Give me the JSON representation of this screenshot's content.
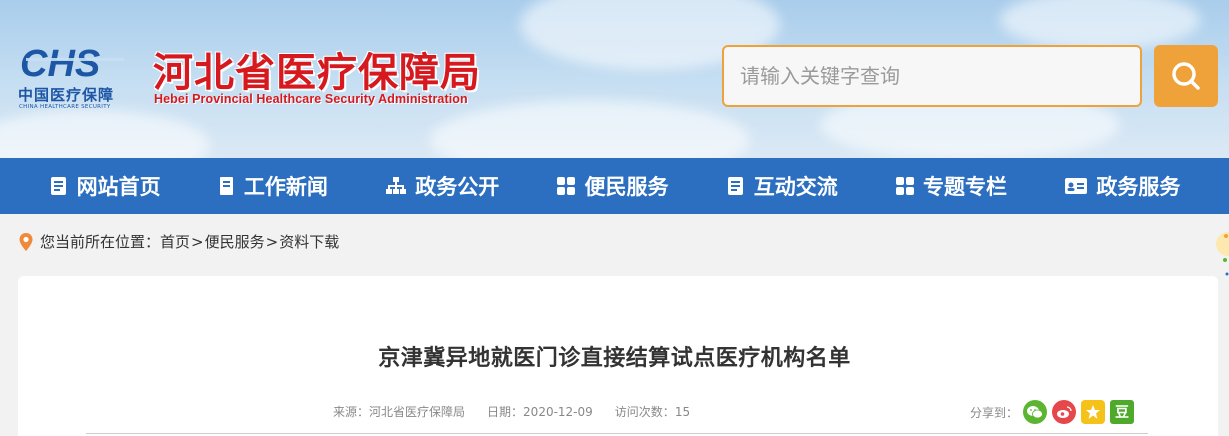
{
  "header": {
    "logo_cn": "中国医疗保障",
    "logo_en": "CHINA HEALTHCARE SECURITY",
    "title": "河北省医疗保障局",
    "subtitle": "Hebei Provincial Healthcare Security Administration"
  },
  "search": {
    "placeholder": "请输入关键字查询",
    "value": ""
  },
  "nav": {
    "items": [
      {
        "label": "网站首页",
        "icon": "list-icon"
      },
      {
        "label": "工作新闻",
        "icon": "bookmark-icon"
      },
      {
        "label": "政务公开",
        "icon": "hierarchy-icon"
      },
      {
        "label": "便民服务",
        "icon": "grid-icon"
      },
      {
        "label": "互动交流",
        "icon": "list-icon"
      },
      {
        "label": "专题专栏",
        "icon": "grid-icon"
      },
      {
        "label": "政务服务",
        "icon": "id-card-icon"
      }
    ]
  },
  "breadcrumb": {
    "prefix": "您当前所在位置：",
    "items": [
      "首页",
      "便民服务",
      "资料下载"
    ],
    "separator": ">"
  },
  "article": {
    "title": "京津冀异地就医门诊直接结算试点医疗机构名单",
    "source_label": "来源：",
    "source": "河北省医疗保障局",
    "date_label": "日期：",
    "date": "2020-12-09",
    "views_label": "访问次数：",
    "views": "15"
  },
  "share": {
    "label": "分享到：",
    "douban_char": "豆",
    "targets": [
      "wechat",
      "weibo",
      "qzone",
      "douban"
    ]
  },
  "colors": {
    "brand_red": "#d5191e",
    "nav_blue": "#2c6fc0",
    "accent_orange": "#f0a23a",
    "wechat_green": "#5cb531",
    "weibo_red": "#e6474a",
    "qzone_yellow": "#f5c21a",
    "douban_green": "#4faa2c"
  }
}
